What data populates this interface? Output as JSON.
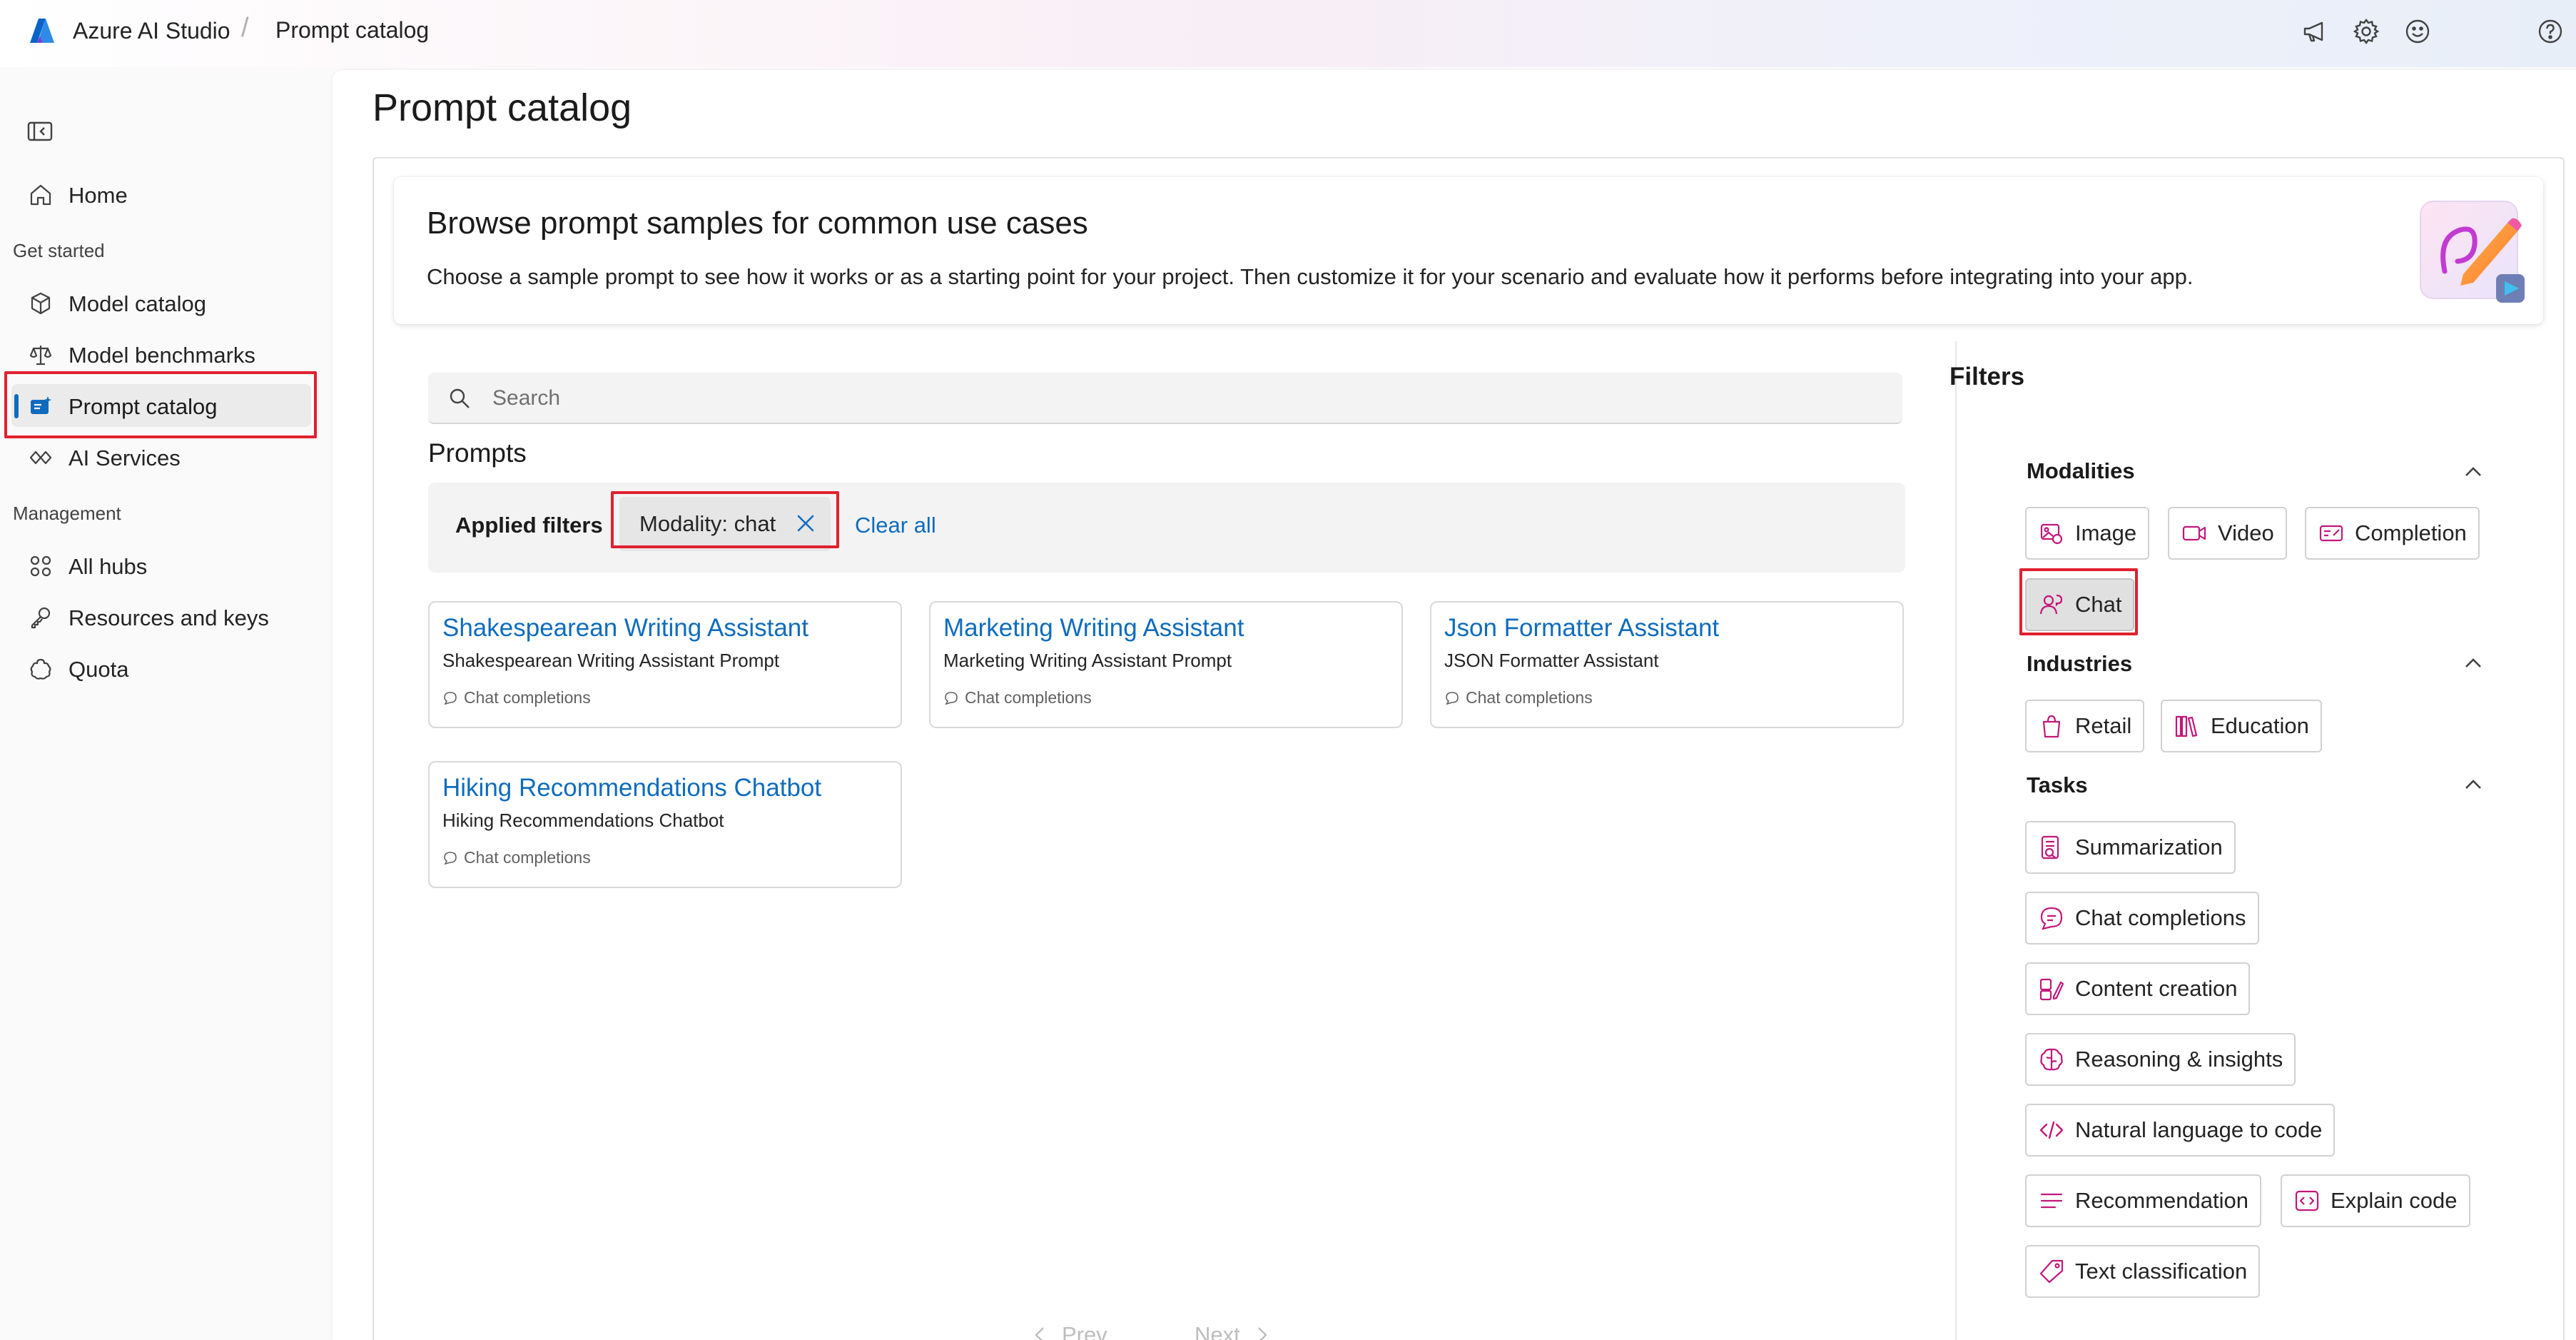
{
  "app": {
    "name": "Azure AI Studio",
    "breadcrumb_separator": "/",
    "breadcrumb_page": "Prompt catalog",
    "top_icons": [
      "megaphone-icon",
      "gear-icon",
      "smiley-icon",
      "help-icon"
    ]
  },
  "nav": {
    "home": "Home",
    "section_get_started": "Get started",
    "model_catalog": "Model catalog",
    "model_benchmarks": "Model benchmarks",
    "prompt_catalog": "Prompt catalog",
    "ai_services": "AI Services",
    "section_management": "Management",
    "all_hubs": "All hubs",
    "resources_and_keys": "Resources and keys",
    "quota": "Quota"
  },
  "main": {
    "title": "Prompt catalog",
    "hero": {
      "title": "Browse prompt samples for common use cases",
      "description": "Choose a sample prompt to see how it works or as a starting point for your project. Then customize it for your scenario and evaluate how it performs before integrating into your app."
    },
    "search": {
      "placeholder": "Search",
      "value": ""
    },
    "prompts_heading": "Prompts",
    "applied_filters": {
      "label": "Applied filters",
      "chip": "Modality: chat",
      "clear_all": "Clear all"
    },
    "cards": [
      {
        "title": "Shakespearean Writing Assistant",
        "description": "Shakespearean Writing Assistant Prompt",
        "tag": "Chat completions"
      },
      {
        "title": "Marketing Writing Assistant",
        "description": "Marketing Writing Assistant Prompt",
        "tag": "Chat completions"
      },
      {
        "title": "Json Formatter Assistant",
        "description": "JSON Formatter Assistant",
        "tag": "Chat completions"
      },
      {
        "title": "Hiking Recommendations Chatbot",
        "description": "Hiking Recommendations Chatbot",
        "tag": "Chat completions"
      }
    ],
    "pager": {
      "prev": "Prev",
      "next": "Next"
    }
  },
  "filters": {
    "heading": "Filters",
    "modalities": {
      "heading": "Modalities",
      "items": [
        "Image",
        "Video",
        "Completion",
        "Chat"
      ],
      "selected": "Chat"
    },
    "industries": {
      "heading": "Industries",
      "items": [
        "Retail",
        "Education"
      ]
    },
    "tasks": {
      "heading": "Tasks",
      "items": [
        "Summarization",
        "Chat completions",
        "Content creation",
        "Reasoning & insights",
        "Natural language to code",
        "Recommendation",
        "Explain code",
        "Text classification"
      ]
    }
  },
  "colors": {
    "accent_link": "#0f6cbd",
    "filter_icon": "#c2177a",
    "highlight_box": "#e0202e"
  }
}
